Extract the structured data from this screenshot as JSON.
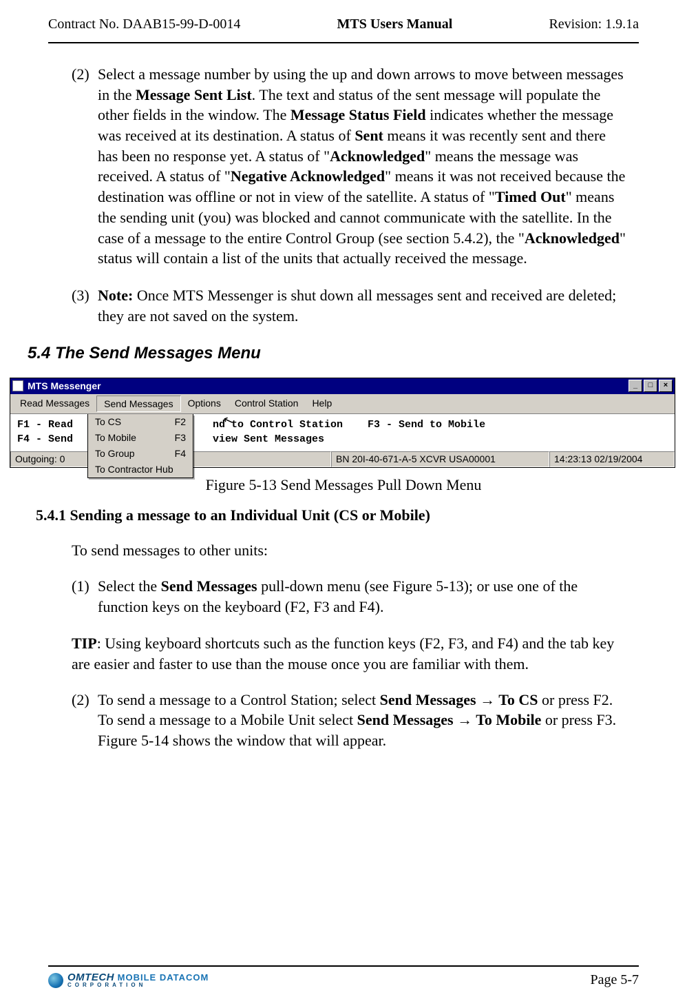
{
  "header": {
    "left": "Contract No. DAAB15-99-D-0014",
    "center": "MTS Users Manual",
    "right": "Revision:  1.9.1a"
  },
  "paragraphs": {
    "p2_num": "(2)",
    "p2_a": "Select a message number by using the up and down arrows to move between messages in the ",
    "p2_b": "Message Sent List",
    "p2_c": ".  The text and status of the sent message will populate the other fields in the window. The ",
    "p2_d": "Message Status Field",
    "p2_e": " indicates whether the message was received at its destination. A status of ",
    "p2_f": "Sent",
    "p2_g": " means it was recently sent and there has been no response yet. A status of \"",
    "p2_h": "Acknowledged",
    "p2_i": "\" means the message was received.  A status of \"",
    "p2_j": "Negative Acknowledged",
    "p2_k": "\" means it was not received because the destination was offline or not in view of the satellite. A status of \"",
    "p2_l": "Timed Out",
    "p2_m": "\" means the sending unit (you) was blocked and cannot communicate with the satellite. In the case of a message to the entire Control Group (see section 5.4.2), the \"",
    "p2_n": "Acknowledged",
    "p2_o": "\" status will contain a list of the units that actually received the message.",
    "p3_num": "(3)",
    "p3_a": "Note:",
    "p3_b": " Once MTS Messenger is shut down all messages sent and received are deleted; they are not saved on the system."
  },
  "section": {
    "heading": "5.4  The Send Messages Menu"
  },
  "screenshot": {
    "title": "MTS Messenger",
    "menus": {
      "read": "Read Messages",
      "send": "Send Messages",
      "options": "Options",
      "control": "Control Station",
      "help": "Help"
    },
    "dropdown": {
      "to_cs": {
        "label": "To CS",
        "key": "F2"
      },
      "to_mobile": {
        "label": "To Mobile",
        "key": "F3"
      },
      "to_group": {
        "label": "To Group",
        "key": "F4"
      },
      "to_hub": {
        "label": "To Contractor Hub",
        "key": ""
      }
    },
    "left_lines": "F1 - Read\nF4 - Send",
    "right_lines": "nd to Control Station    F3 - Send to Mobile\nview Sent Messages",
    "status": {
      "outgoing": "Outgoing: 0",
      "mid": "BN 20I-40-671-A-5  XCVR USA00001",
      "time": "14:23:13 02/19/2004"
    },
    "winbtn": {
      "min": "_",
      "max": "□",
      "close": "×"
    }
  },
  "figure_caption": "Figure 5-13   Send Messages Pull Down Menu",
  "subsection": {
    "heading": "5.4.1  Sending a message to an Individual Unit (CS or Mobile)",
    "intro": "To send messages to other units:",
    "s1_num": "(1)",
    "s1_a": "Select the ",
    "s1_b": "Send Messages",
    "s1_c": " pull-down menu (see Figure 5-13); or use one of the function keys on the keyboard (F2, F3 and F4).",
    "tip_a": "TIP",
    "tip_b": ": Using keyboard shortcuts such as the function keys (F2, F3, and F4) and the tab key are easier and faster to use than the mouse once you are familiar with them.",
    "s2_num": "(2)",
    "s2_a": "To send a message to a Control Station; select ",
    "s2_b": "Send Messages ",
    "s2_arrow1": "→",
    "s2_c": " To CS",
    "s2_d": " or press F2. To send a message to a Mobile Unit select ",
    "s2_e": "Send Messages ",
    "s2_arrow2": "→",
    "s2_f": " To Mobile",
    "s2_g": " or press F3. Figure 5-14 shows the window that will appear."
  },
  "footer": {
    "logo_brand": "OMTECH",
    "logo_md": "MOBILE DATACOM",
    "logo_corp": "CORPORATION",
    "page": "Page 5-7"
  }
}
